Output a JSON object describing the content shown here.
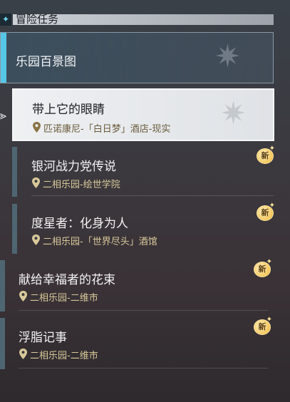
{
  "header": {
    "icon": "diamond-icon",
    "title": "冒险任务"
  },
  "group": {
    "title": "乐园百景图"
  },
  "quests": [
    {
      "title": "带上它的眼睛",
      "location": "匹诺康尼-「白日梦」酒店-现实",
      "selected": true,
      "new": false
    },
    {
      "title": "银河战力党传说",
      "location": "二相乐园-绘世学院",
      "selected": false,
      "new": true
    },
    {
      "title": "度星者：化身为人",
      "location": "二相乐园-「世界尽头」酒馆",
      "selected": false,
      "new": true
    },
    {
      "title": "献给幸福者的花束",
      "location": "二相乐园-二维市",
      "selected": false,
      "new": true
    },
    {
      "title": "浮脂记事",
      "location": "二相乐园-二维市",
      "selected": false,
      "new": true
    }
  ],
  "badge_label": "新",
  "colors": {
    "accent_cyan": "#56c6e6",
    "location_text": "#d9c99a",
    "badge_gold": "#f3c65a"
  }
}
